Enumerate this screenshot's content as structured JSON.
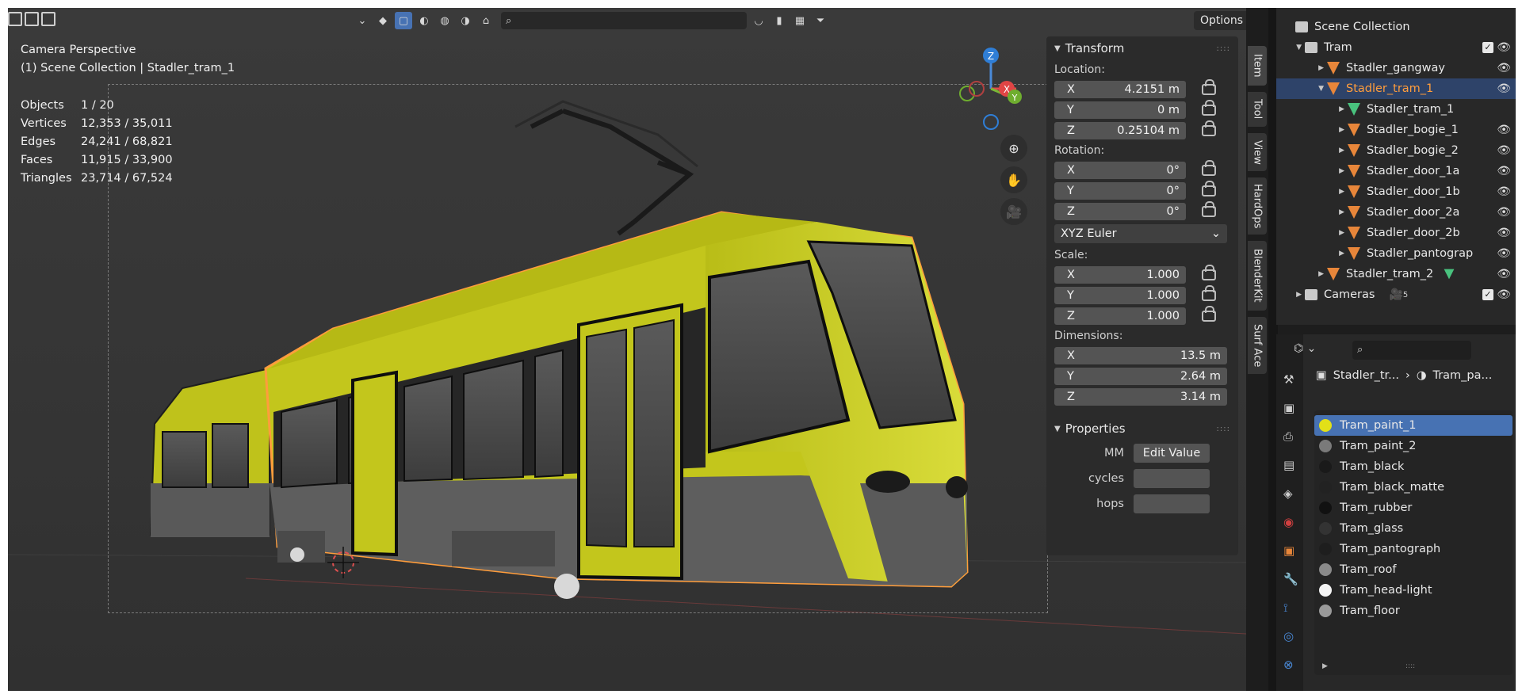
{
  "viewport": {
    "options_label": "Options",
    "search_placeholder": "",
    "overlay": {
      "mode": "Camera Perspective",
      "collection": "(1) Scene Collection | Stadler_tram_1"
    },
    "stats": [
      {
        "key": "Objects",
        "value": "1 / 20"
      },
      {
        "key": "Vertices",
        "value": "12,353 / 35,011"
      },
      {
        "key": "Edges",
        "value": "24,241 / 68,821"
      },
      {
        "key": "Faces",
        "value": "11,915 / 33,900"
      },
      {
        "key": "Triangles",
        "value": "23,714 / 67,524"
      }
    ],
    "gizmo": {
      "z": "Z",
      "x": "X",
      "y": "Y"
    }
  },
  "npanel": {
    "transform": {
      "title": "Transform",
      "location_label": "Location:",
      "location": [
        {
          "axis": "X",
          "value": "4.2151 m"
        },
        {
          "axis": "Y",
          "value": "0 m"
        },
        {
          "axis": "Z",
          "value": "0.25104 m"
        }
      ],
      "rotation_label": "Rotation:",
      "rotation": [
        {
          "axis": "X",
          "value": "0°"
        },
        {
          "axis": "Y",
          "value": "0°"
        },
        {
          "axis": "Z",
          "value": "0°"
        }
      ],
      "rotation_mode": "XYZ Euler",
      "scale_label": "Scale:",
      "scale": [
        {
          "axis": "X",
          "value": "1.000"
        },
        {
          "axis": "Y",
          "value": "1.000"
        },
        {
          "axis": "Z",
          "value": "1.000"
        }
      ],
      "dimensions_label": "Dimensions:",
      "dimensions": [
        {
          "axis": "X",
          "value": "13.5 m"
        },
        {
          "axis": "Y",
          "value": "2.64 m"
        },
        {
          "axis": "Z",
          "value": "3.14 m"
        }
      ]
    },
    "properties": {
      "title": "Properties",
      "mm_key": "MM",
      "mm_button": "Edit Value",
      "cycles_key": "cycles",
      "hops_key": "hops"
    },
    "tabs": [
      "Item",
      "Tool",
      "View",
      "HardOps",
      "BlenderKit",
      "Surf Ace"
    ]
  },
  "outliner": {
    "rows": [
      {
        "label": "Scene Collection",
        "indent": 0,
        "type": "collection",
        "arrow": ""
      },
      {
        "label": "Tram",
        "indent": 1,
        "type": "collection",
        "arrow": "▼",
        "check": true,
        "eye": true
      },
      {
        "label": "Stadler_gangway",
        "indent": 2,
        "type": "mesh",
        "arrow": "▶",
        "eye": true
      },
      {
        "label": "Stadler_tram_1",
        "indent": 2,
        "type": "mesh",
        "arrow": "▼",
        "eye": true,
        "selected": true
      },
      {
        "label": "Stadler_tram_1",
        "indent": 3,
        "type": "data",
        "arrow": "▶"
      },
      {
        "label": "Stadler_bogie_1",
        "indent": 3,
        "type": "mesh",
        "arrow": "▶",
        "eye": true
      },
      {
        "label": "Stadler_bogie_2",
        "indent": 3,
        "type": "mesh",
        "arrow": "▶",
        "eye": true
      },
      {
        "label": "Stadler_door_1a",
        "indent": 3,
        "type": "mesh",
        "arrow": "▶",
        "eye": true
      },
      {
        "label": "Stadler_door_1b",
        "indent": 3,
        "type": "mesh",
        "arrow": "▶",
        "eye": true
      },
      {
        "label": "Stadler_door_2a",
        "indent": 3,
        "type": "mesh",
        "arrow": "▶",
        "eye": true
      },
      {
        "label": "Stadler_door_2b",
        "indent": 3,
        "type": "mesh",
        "arrow": "▶",
        "eye": true
      },
      {
        "label": "Stadler_pantograp",
        "indent": 3,
        "type": "mesh",
        "arrow": "▶",
        "eye": true
      },
      {
        "label": "Stadler_tram_2",
        "indent": 2,
        "type": "mesh",
        "arrow": "▶",
        "eye": true
      },
      {
        "label": "Cameras",
        "indent": 1,
        "type": "collection",
        "arrow": "▶",
        "check": true,
        "eye": true,
        "badge": "5"
      }
    ]
  },
  "properties_editor": {
    "breadcrumb_object": "Stadler_tr...",
    "breadcrumb_material": "Tram_pa...",
    "materials": [
      {
        "name": "Tram_paint_1",
        "color": "#e2e018",
        "selected": true
      },
      {
        "name": "Tram_paint_2",
        "color": "#7a7a7a"
      },
      {
        "name": "Tram_black",
        "color": "#1a1a1a"
      },
      {
        "name": "Tram_black_matte",
        "color": "#222222"
      },
      {
        "name": "Tram_rubber",
        "color": "#111111"
      },
      {
        "name": "Tram_glass",
        "color": "#333333"
      },
      {
        "name": "Tram_pantograph",
        "color": "#1e1e1e"
      },
      {
        "name": "Tram_roof",
        "color": "#8a8a8a"
      },
      {
        "name": "Tram_head-light",
        "color": "#f4f4f4"
      },
      {
        "name": "Tram_floor",
        "color": "#9a9a9a"
      }
    ]
  },
  "colors": {
    "accent": "#4772b3",
    "selection_orange": "#ff9d3c",
    "tram_yellow": "#c9cc1e"
  }
}
